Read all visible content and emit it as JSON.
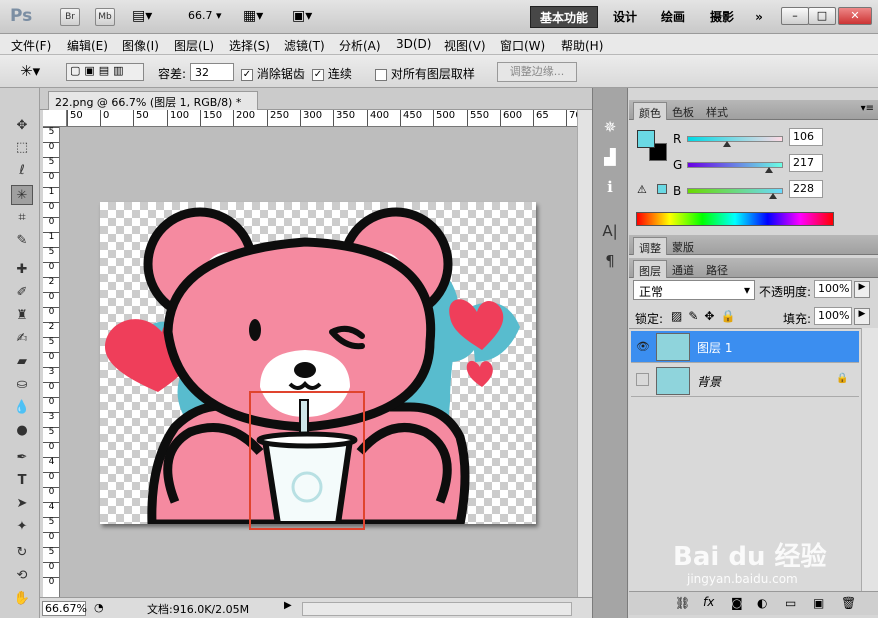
{
  "appbar": {
    "logo": "Ps",
    "btn_br": "Br",
    "btn_mb": "Mb",
    "zoom": "66.7",
    "workspaces": [
      "基本功能",
      "设计",
      "绘画",
      "摄影"
    ],
    "more": "»",
    "win_min": "–",
    "win_restore": "□",
    "win_close": "✕"
  },
  "menu": [
    "文件(F)",
    "编辑(E)",
    "图像(I)",
    "图层(L)",
    "选择(S)",
    "滤镜(T)",
    "分析(A)",
    "3D(D)",
    "视图(V)",
    "窗口(W)",
    "帮助(H)"
  ],
  "options": {
    "tolerance_label": "容差:",
    "tolerance_value": "32",
    "antialias_label": "消除锯齿",
    "contiguous_label": "连续",
    "sample_all_label": "对所有图层取样",
    "refine_edge_label": "调整边缘..."
  },
  "document": {
    "tab_title": "22.png @ 66.7% (图层 1, RGB/8) *",
    "tab_close": "✕",
    "ruler_top": [
      "50",
      "0",
      "50",
      "100",
      "150",
      "200",
      "250",
      "300",
      "350",
      "400",
      "450",
      "500",
      "550",
      "600",
      "65",
      "70"
    ],
    "ruler_left": [
      "5",
      "0",
      "5",
      "0",
      "1",
      "0",
      "0",
      "1",
      "5",
      "0",
      "2",
      "0",
      "0",
      "2",
      "5",
      "0",
      "3",
      "0",
      "0",
      "3",
      "5",
      "0",
      "4",
      "0",
      "0",
      "4",
      "5",
      "0",
      "5",
      "0",
      "0"
    ],
    "status_zoom": "66.67%",
    "status_doc": "文档:916.0K/2.05M"
  },
  "panels": {
    "color": {
      "tabs": [
        "颜色",
        "色板",
        "样式"
      ],
      "r_label": "R",
      "g_label": "G",
      "b_label": "B",
      "r": "106",
      "g": "217",
      "b": "228",
      "fg_color": "#6ad9e4"
    },
    "adjust": {
      "tabs": [
        "调整",
        "蒙版"
      ]
    },
    "layers": {
      "tabs": [
        "图层",
        "通道",
        "路径"
      ],
      "blend_mode": "正常",
      "opacity_label": "不透明度:",
      "opacity": "100%",
      "lock_label": "锁定:",
      "fill_label": "填充:",
      "fill": "100%",
      "rows": [
        {
          "name": "图层 1"
        },
        {
          "name": "背景"
        }
      ]
    }
  },
  "watermark": {
    "brand": "Bai du 经验",
    "url": "jingyan.baidu.com"
  }
}
